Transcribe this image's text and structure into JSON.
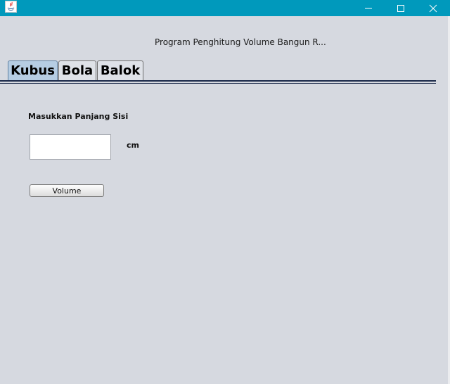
{
  "window": {
    "minimize_symbol": "—",
    "maximize_symbol": "□",
    "close_symbol": "✕",
    "icon": "java-icon",
    "titlebar_color": "#0099bc"
  },
  "header": {
    "title": "Program Penghitung Volume Bangun R..."
  },
  "tabs": [
    {
      "label": "Kubus",
      "selected": true
    },
    {
      "label": "Bola",
      "selected": false
    },
    {
      "label": "Balok",
      "selected": false
    }
  ],
  "form": {
    "field_label": "Masukkan Panjang Sisi",
    "input_value": "",
    "unit": "cm",
    "button_label": "Volume"
  },
  "colors": {
    "background": "#d6d9e0",
    "selected_tab": "#b6cde3"
  }
}
